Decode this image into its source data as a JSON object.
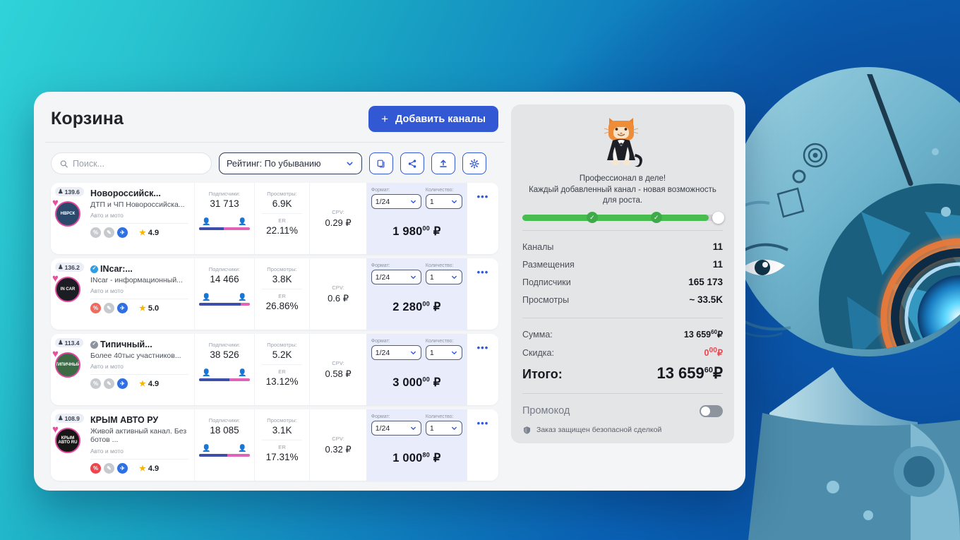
{
  "theme": {
    "accent": "#3358d4",
    "bg_gradient_from": "#2fd3d8",
    "bg_gradient_to": "#0752a8",
    "price_bg": "#e9edfb",
    "progress_green": "#46bd4e",
    "discount_red": "#f0444c"
  },
  "header": {
    "title": "Корзина",
    "add_channels_label": "Добавить каналы",
    "plus_icon": "plus-icon"
  },
  "toolbar": {
    "search_placeholder": "Поиск...",
    "search_value": "",
    "search_icon": "search-icon",
    "sort_value": "Рейтинг: По убыванию",
    "chevron_icon": "chevron-down-icon",
    "buttons": [
      {
        "name": "copy-button",
        "icon": "copy-icon"
      },
      {
        "name": "share-button",
        "icon": "share-icon"
      },
      {
        "name": "upload-button",
        "icon": "upload-icon"
      },
      {
        "name": "settings-button",
        "icon": "gear-icon"
      }
    ]
  },
  "labels": {
    "subscribers": "Подписчики:",
    "views": "Просмотры:",
    "er": "ER",
    "cpv": "CPV:",
    "format": "Формат:",
    "quantity": "Количество:",
    "menu_icon": "more-options-icon"
  },
  "channels": [
    {
      "rank": "139.6",
      "name": "Новороссийск...",
      "verified": false,
      "verified_color": "",
      "description": "ДТП и ЧП Новороссийска...",
      "category": "Авто и мото",
      "avatar_text": "НВРСК",
      "avatar_bg": "#2b4a6b",
      "social": [
        {
          "name": "percent-icon",
          "glyph": "%",
          "color": "#c6c9ce"
        },
        {
          "name": "pen-icon",
          "glyph": "✎",
          "color": "#c6c9ce"
        },
        {
          "name": "telegram-icon",
          "glyph": "✈",
          "color": "#2f6fe4"
        }
      ],
      "rating": "4.9",
      "subscribers": "31 713",
      "male_pct": 48,
      "views": "6.9K",
      "er": "22.11%",
      "cpv": "0.29 ₽",
      "format": "1/24",
      "quantity": "1",
      "price_main": "1 980",
      "price_cents": "00",
      "currency": "₽"
    },
    {
      "rank": "136.2",
      "name": "INcar:...",
      "verified": true,
      "verified_color": "#2f9fe4",
      "description": "INcar - информационный...",
      "category": "Авто и мото",
      "avatar_text": "IN CAR",
      "avatar_bg": "#1b1d22",
      "social": [
        {
          "name": "percent-icon",
          "glyph": "%",
          "color": "#f06a5e"
        },
        {
          "name": "pen-icon",
          "glyph": "✎",
          "color": "#c6c9ce"
        },
        {
          "name": "telegram-icon",
          "glyph": "✈",
          "color": "#2f6fe4"
        }
      ],
      "rating": "5.0",
      "subscribers": "14 466",
      "male_pct": 82,
      "views": "3.8K",
      "er": "26.86%",
      "cpv": "0.6 ₽",
      "format": "1/24",
      "quantity": "1",
      "price_main": "2 280",
      "price_cents": "00",
      "currency": "₽"
    },
    {
      "rank": "113.4",
      "name": "Типичный...",
      "verified": true,
      "verified_color": "#8d939e",
      "description": "Более 40тыс участников...",
      "category": "Авто и мото",
      "avatar_text": "ТИПИЧНЫЙ",
      "avatar_bg": "#3c6a45",
      "social": [
        {
          "name": "percent-icon",
          "glyph": "%",
          "color": "#c6c9ce"
        },
        {
          "name": "pen-icon",
          "glyph": "✎",
          "color": "#c6c9ce"
        },
        {
          "name": "telegram-icon",
          "glyph": "✈",
          "color": "#2f6fe4"
        }
      ],
      "rating": "4.9",
      "subscribers": "38 526",
      "male_pct": 60,
      "views": "5.2K",
      "er": "13.12%",
      "cpv": "0.58 ₽",
      "format": "1/24",
      "quantity": "1",
      "price_main": "3 000",
      "price_cents": "00",
      "currency": "₽"
    },
    {
      "rank": "108.9",
      "name": "КРЫМ АВТО РУ",
      "verified": false,
      "verified_color": "",
      "description": "Живой активный канал. Без ботов ...",
      "category": "Авто и мото",
      "avatar_text": "КРЫМ АВТО RU",
      "avatar_bg": "#171715",
      "social": [
        {
          "name": "percent-icon",
          "glyph": "%",
          "color": "#f0444c"
        },
        {
          "name": "pen-icon",
          "glyph": "✎",
          "color": "#c6c9ce"
        },
        {
          "name": "telegram-icon",
          "glyph": "✈",
          "color": "#2f6fe4"
        }
      ],
      "rating": "4.9",
      "subscribers": "18 085",
      "male_pct": 55,
      "views": "3.1K",
      "er": "17.31%",
      "cpv": "0.32 ₽",
      "format": "1/24",
      "quantity": "1",
      "price_main": "1 000",
      "price_cents": "80",
      "currency": "₽"
    }
  ],
  "summary": {
    "mascot_icon": "cat-in-suit-mascot",
    "promo_line1": "Профессионал в деле!",
    "promo_line2": "Каждый добавленный канал - новая возможность для роста.",
    "progress_pct": 93,
    "stats": [
      {
        "key": "Каналы",
        "value": "11"
      },
      {
        "key": "Размещения",
        "value": "11"
      },
      {
        "key": "Подписчики",
        "value": "165 173"
      },
      {
        "key": "Просмотры",
        "value": "~ 33.5K"
      }
    ],
    "sum_label": "Сумма:",
    "sum_main": "13 659",
    "sum_cents": "60",
    "discount_label": "Скидка:",
    "discount_main": "0",
    "discount_cents": "00",
    "total_label": "Итого:",
    "total_main": "13 659",
    "total_cents": "60",
    "currency": "₽",
    "promocode_label": "Промокод",
    "promocode_enabled": false,
    "secure_icon": "shield-icon",
    "secure_text": "Заказ защищен безопасной сделкой"
  }
}
